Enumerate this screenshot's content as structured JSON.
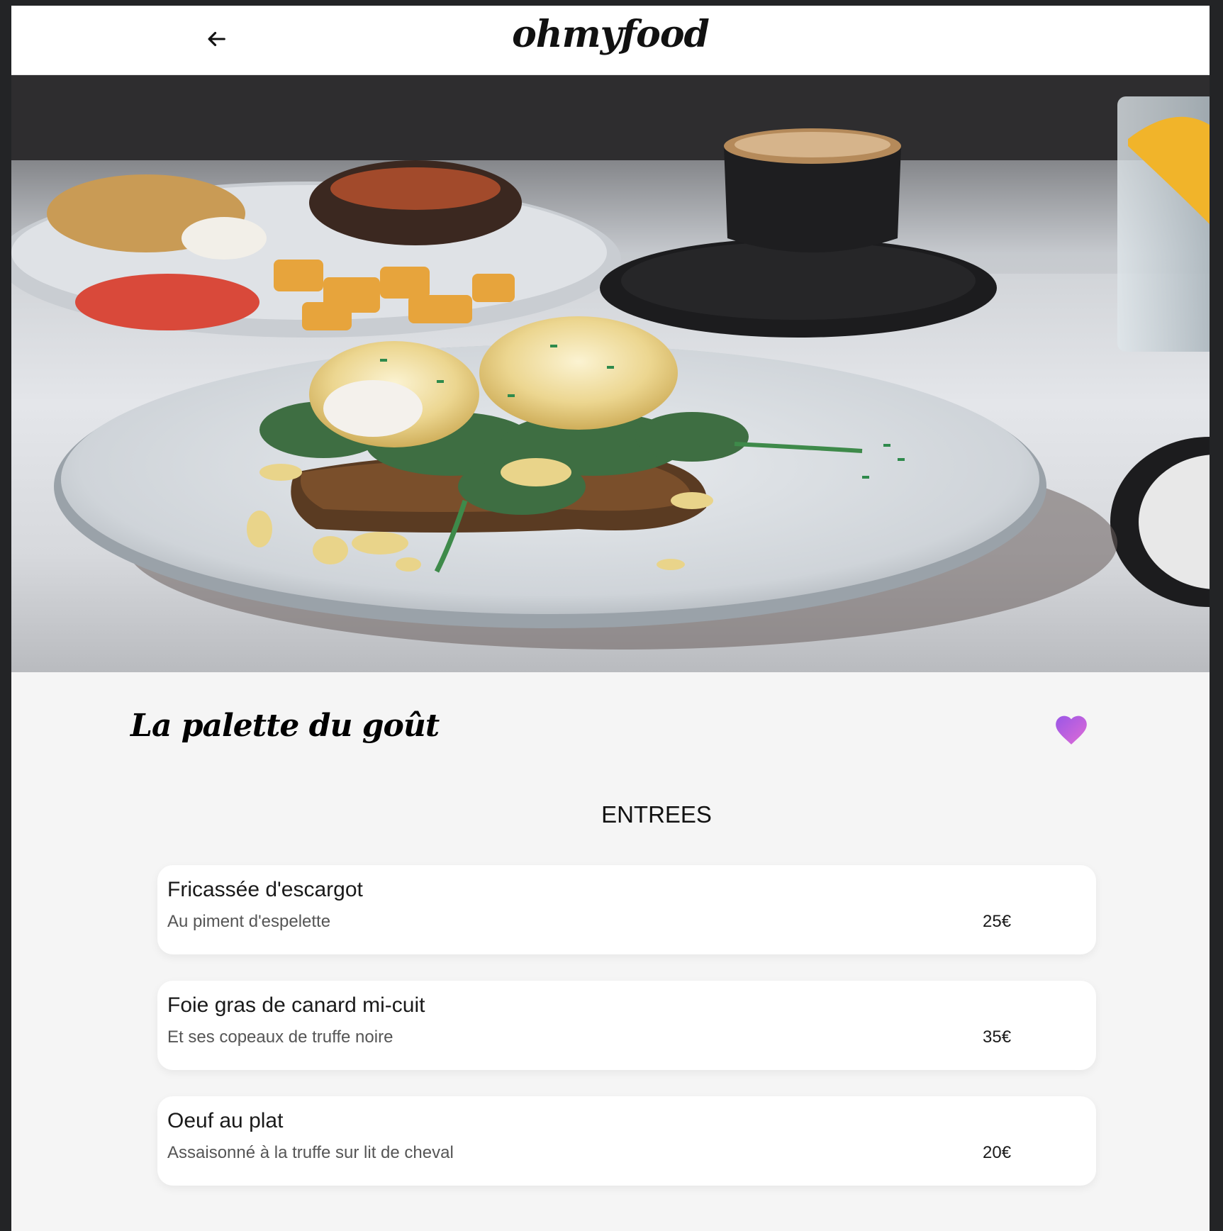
{
  "header": {
    "back_icon": "arrow-left-icon",
    "logo": "ohmyfood"
  },
  "hero": {
    "image": "photo of poached eggs on toast with spinach and hollandaise, breakfast plates and coffee in background"
  },
  "restaurant": {
    "name": "La palette du goût",
    "like_icon": "heart-icon",
    "like_color": "#b55fe0"
  },
  "menu": {
    "section_title": "ENTREES",
    "items": [
      {
        "name": "Fricassée d'escargot",
        "description": "Au piment d'espelette",
        "price": "25€"
      },
      {
        "name": "Foie gras de canard mi-cuit",
        "description": "Et ses copeaux de truffe noire",
        "price": "35€"
      },
      {
        "name": "Oeuf au plat",
        "description": "Assaisonné à la truffe sur lit de cheval",
        "price": "20€"
      }
    ]
  }
}
